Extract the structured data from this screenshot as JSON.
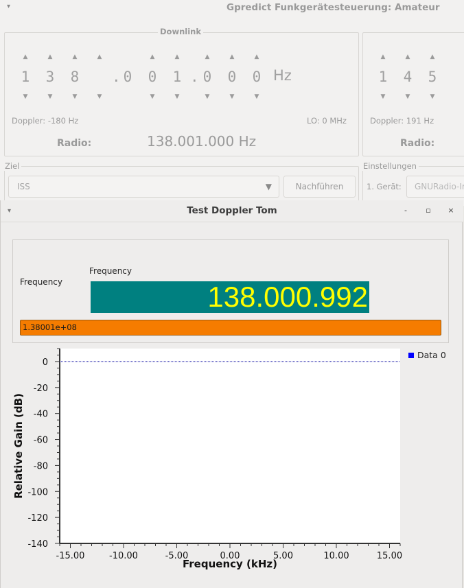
{
  "gpredict": {
    "title": "Gpredict Funkgerätesteuerung: Amateur",
    "menu_glyph": "▾",
    "downlink": {
      "label": "Downlink",
      "digits": [
        "1",
        "3",
        "8",
        "0",
        "0",
        "1",
        "0",
        "0",
        "0"
      ],
      "separators": [
        ".",
        "."
      ],
      "unit": "Hz",
      "doppler": "Doppler: -180 Hz",
      "lo": "LO:  0 MHz",
      "radio_label": "Radio:",
      "radio_value": "138.001.000 Hz"
    },
    "uplink": {
      "digits": [
        "1",
        "4",
        "5"
      ],
      "doppler": "Doppler: 191 Hz",
      "radio_label": "Radio:"
    },
    "ziel": {
      "label": "Ziel",
      "target": "ISS",
      "track_button": "Nachführen"
    },
    "einstellungen": {
      "label": "Einstellungen",
      "device_label": "1. Gerät:",
      "device_value": "GNURadio-Ir"
    }
  },
  "gnuradio": {
    "title": "Test Doppler Tom",
    "menu_glyph": "▾",
    "window_buttons": {
      "minimize": "-",
      "maximize": "▫",
      "close": "×"
    },
    "freq_group_label": "Frequency",
    "lcd_label": "Frequency",
    "lcd_value": "138.000.992",
    "bar_value": "1.38001e+08",
    "colors": {
      "lcd_bg": "#008080",
      "lcd_fg": "#ffff00",
      "bar": "#f57c00",
      "trace": "#00009c",
      "legend": "#0000ff"
    }
  },
  "chart_data": {
    "type": "line",
    "xlabel": "Frequency (kHz)",
    "ylabel": "Relative Gain (dB)",
    "xlim": [
      -16,
      16
    ],
    "ylim": [
      -140,
      10
    ],
    "xticks": [
      -15,
      -10,
      -5,
      0,
      5,
      10,
      15
    ],
    "xtick_labels": [
      "-15.00",
      "-10.00",
      "-5.00",
      "0.00",
      "5.00",
      "10.00",
      "15.00"
    ],
    "yticks": [
      0,
      -20,
      -40,
      -60,
      -80,
      -100,
      -120,
      -140
    ],
    "ytick_labels": [
      "0",
      "-20",
      "-40",
      "-60",
      "-80",
      "-100",
      "-120",
      "-140"
    ],
    "grid": false,
    "legend": "right",
    "series": [
      {
        "name": "Data 0",
        "x": [
          -16,
          16
        ],
        "values": [
          0,
          0
        ]
      }
    ]
  }
}
